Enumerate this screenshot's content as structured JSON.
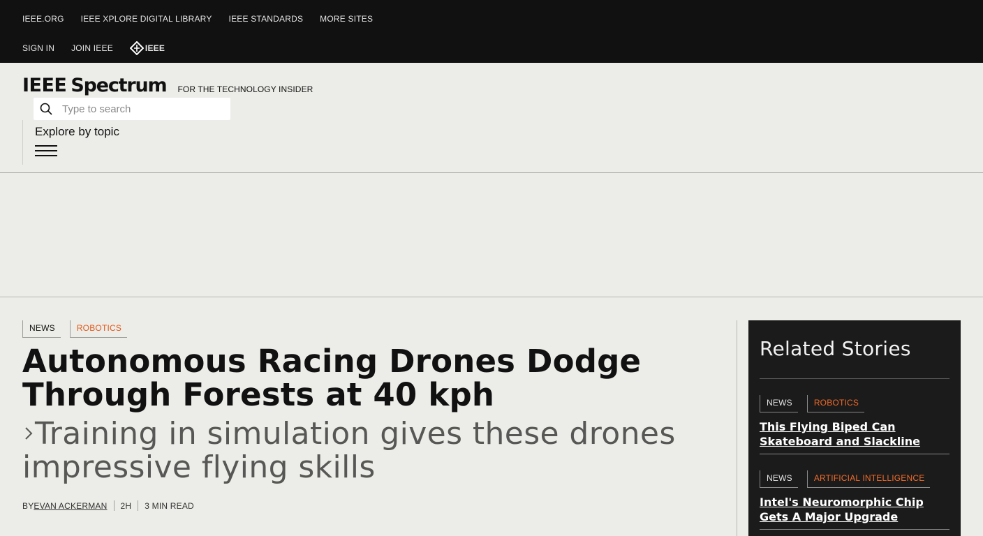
{
  "top_nav": {
    "links": [
      "IEEE.ORG",
      "IEEE XPLORE DIGITAL LIBRARY",
      "IEEE STANDARDS",
      "MORE SITES"
    ],
    "sign_in": "SIGN IN",
    "join": "JOIN IEEE",
    "ieee_logo_text": "IEEE"
  },
  "masthead": {
    "logo_ieee": "IEEE",
    "logo_spectrum": "Spectrum",
    "tagline": "FOR THE TECHNOLOGY INSIDER",
    "search_placeholder": "Type to search",
    "explore_label": "Explore by topic"
  },
  "article": {
    "tags": [
      {
        "label": "NEWS",
        "accent": false
      },
      {
        "label": "ROBOTICS",
        "accent": true
      }
    ],
    "headline": "Autonomous Racing Drones Dodge Through Forests at 40 kph",
    "subhead": "Training in simulation gives these drones impressive flying skills",
    "byline_prefix": "BY",
    "author": "EVAN ACKERMAN",
    "time_ago": "2H",
    "read_time": "3 MIN READ"
  },
  "related": {
    "heading": "Related Stories",
    "stories": [
      {
        "tag1": "NEWS",
        "tag2": "ROBOTICS",
        "title": "This Flying Biped Can Skateboard and Slackline"
      },
      {
        "tag1": "NEWS",
        "tag2": "ARTIFICIAL INTELLIGENCE",
        "title": "Intel's Neuromorphic Chip Gets A Major Upgrade"
      }
    ]
  },
  "colors": {
    "topbar_bg": "#111111",
    "page_bg": "#ecece8",
    "accent": "#e35a1a",
    "related_bg": "#1b1b1b"
  }
}
